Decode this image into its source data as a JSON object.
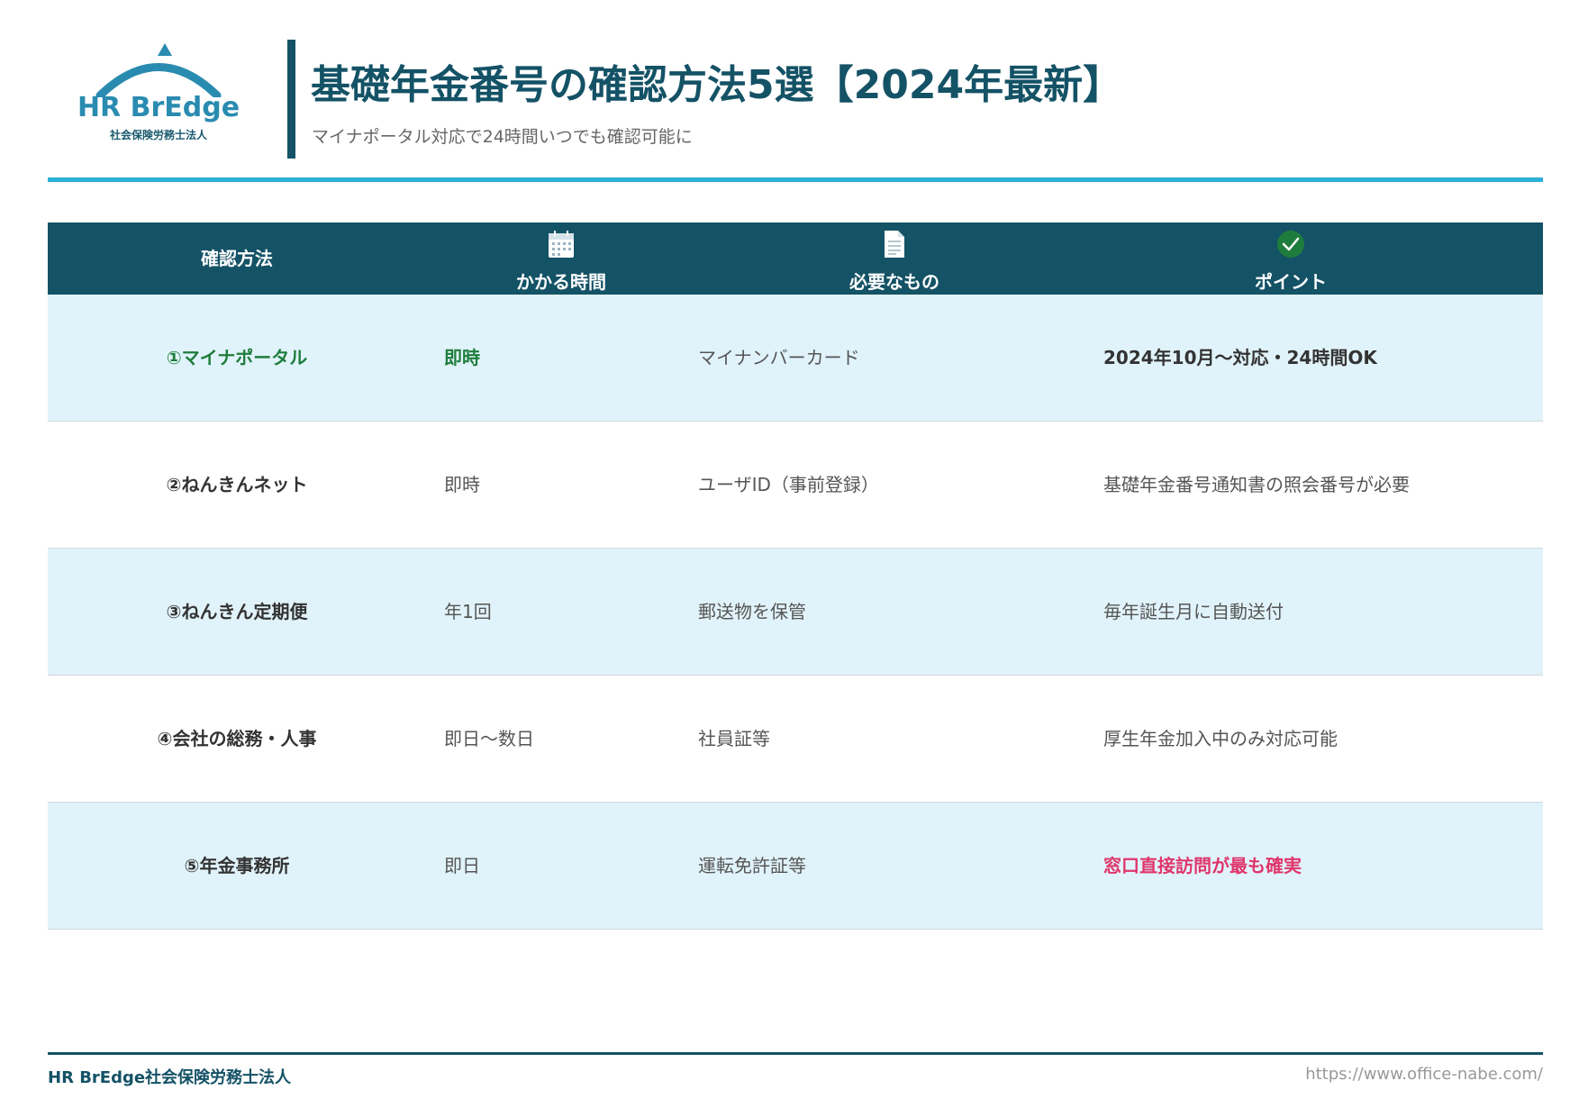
{
  "header": {
    "logo_name": "HR BrEdge",
    "logo_sub": "社会保険労務士法人",
    "title": "基礎年金番号の確認方法5選【2024年最新】",
    "subtitle": "マイナポータル対応で24時間いつでも確認可能に"
  },
  "table": {
    "headers": {
      "method": "確認方法",
      "time": "かかる時間",
      "need": "必要なもの",
      "point": "ポイント"
    },
    "header_icons": {
      "time": "calendar-icon",
      "need": "document-icon",
      "point": "check-circle-icon"
    },
    "rows": [
      {
        "method": "①マイナポータル",
        "time": "即時",
        "need": "マイナンバーカード",
        "point": "2024年10月～対応・24時間OK"
      },
      {
        "method": "②ねんきんネット",
        "time": "即時",
        "need": "ユーザID（事前登録）",
        "point": "基礎年金番号通知書の照会番号が必要"
      },
      {
        "method": "③ねんきん定期便",
        "time": "年1回",
        "need": "郵送物を保管",
        "point": "毎年誕生月に自動送付"
      },
      {
        "method": "④会社の総務・人事",
        "time": "即日～数日",
        "need": "社員証等",
        "point": "厚生年金加入中のみ対応可能"
      },
      {
        "method": "⑤年金事務所",
        "time": "即日",
        "need": "運転免許証等",
        "point": "窓口直接訪問が最も確実"
      }
    ]
  },
  "footer": {
    "left": "HR BrEdge社会保険労務士法人",
    "right": "https://www.office-nabe.com/"
  },
  "colors": {
    "primary": "#145266",
    "accent": "#2bb0d6",
    "row_alt": "#e1f3fa",
    "green": "#1e7d3c",
    "red": "#e0356b"
  }
}
